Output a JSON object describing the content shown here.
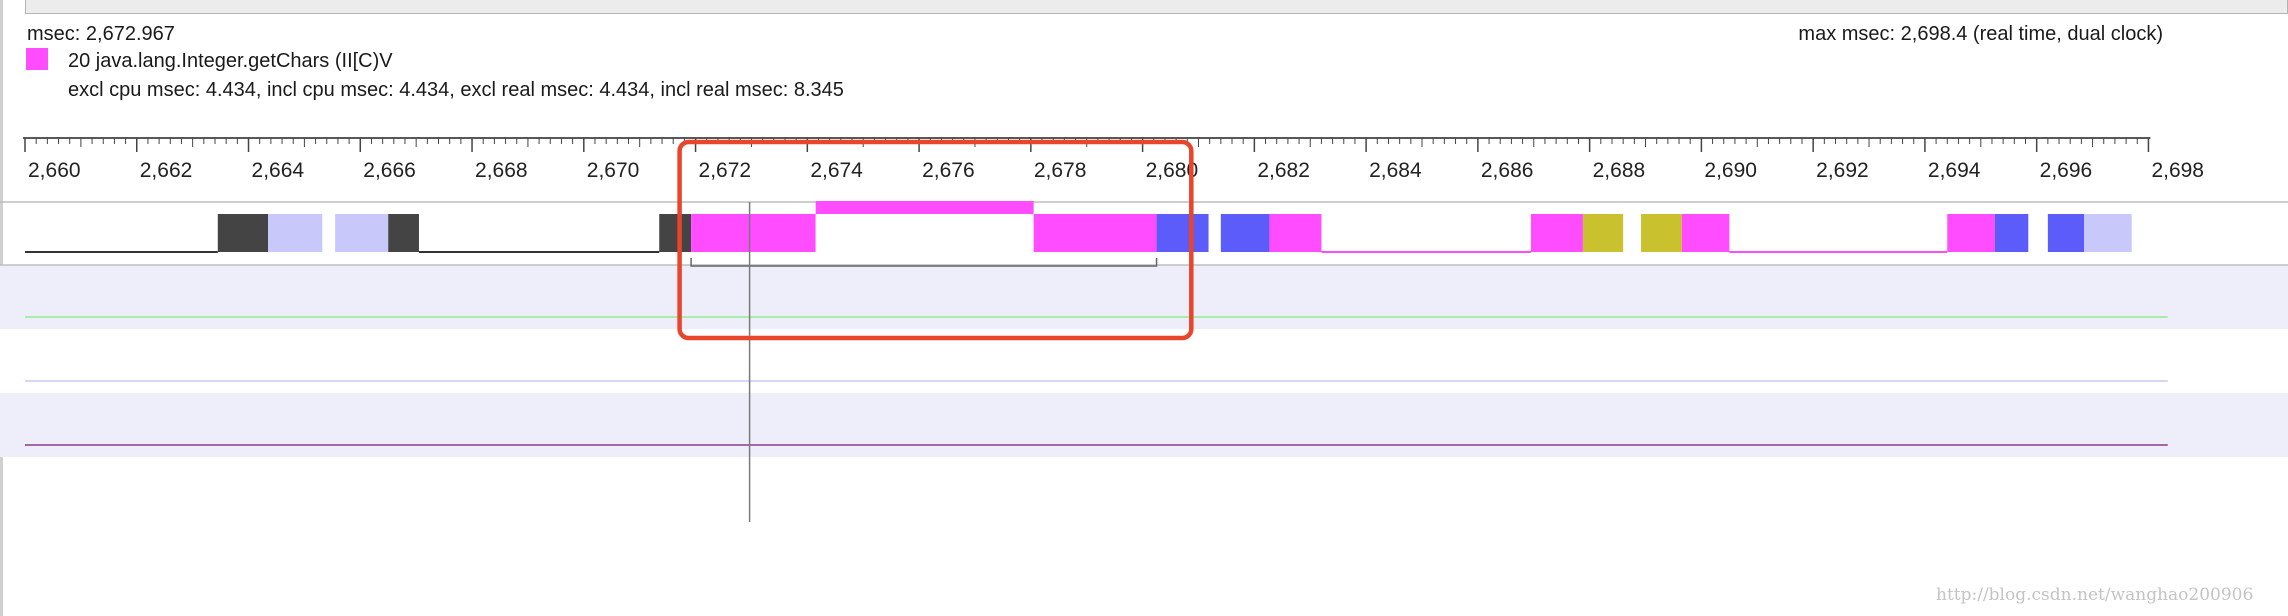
{
  "header": {
    "cursor_time": "msec: 2,672.967",
    "max_time": "max msec: 2,698.4 (real time, dual clock)",
    "method_name": "20 java.lang.Integer.getChars (II[C)V",
    "method_color": "#ff4cff",
    "method_stats": "excl cpu msec: 4.434, incl cpu msec: 4.434, excl real msec: 4.434, incl real msec: 8.345"
  },
  "ruler": {
    "labels": [
      "2,660",
      "2,662",
      "2,664",
      "2,666",
      "2,668",
      "2,670",
      "2,672",
      "2,674",
      "2,676",
      "2,678",
      "2,680",
      "2,682",
      "2,684",
      "2,686",
      "2,688",
      "2,690",
      "2,692",
      "2,694",
      "2,696",
      "2,698"
    ]
  },
  "timeline": {
    "cursor_msec": 2672.967,
    "max_msec": 2698.4,
    "segments": [
      {
        "start": 2663.45,
        "end": 2664.35,
        "color": "#444444"
      },
      {
        "start": 2664.35,
        "end": 2665.32,
        "color": "#c8c8fa"
      },
      {
        "start": 2665.55,
        "end": 2666.5,
        "color": "#c8c8fa"
      },
      {
        "start": 2666.5,
        "end": 2667.05,
        "color": "#444444"
      },
      {
        "start": 2671.35,
        "end": 2671.92,
        "color": "#444444"
      },
      {
        "start": 2671.92,
        "end": 2674.15,
        "color": "#ff4cff"
      },
      {
        "start": 2674.15,
        "end": 2678.05,
        "color": "#ffffff"
      },
      {
        "start": 2678.05,
        "end": 2680.25,
        "color": "#ff4cff"
      },
      {
        "start": 2680.25,
        "end": 2681.18,
        "color": "#5c5cfa"
      },
      {
        "start": 2681.4,
        "end": 2682.27,
        "color": "#5c5cfa"
      },
      {
        "start": 2682.27,
        "end": 2683.2,
        "color": "#ff4cff"
      },
      {
        "start": 2686.95,
        "end": 2687.88,
        "color": "#ff4cff"
      },
      {
        "start": 2687.88,
        "end": 2688.6,
        "color": "#c9c22e"
      },
      {
        "start": 2688.92,
        "end": 2689.65,
        "color": "#c9c22e"
      },
      {
        "start": 2689.65,
        "end": 2690.5,
        "color": "#ff4cff"
      },
      {
        "start": 2694.4,
        "end": 2695.25,
        "color": "#ff4cff"
      },
      {
        "start": 2695.25,
        "end": 2695.85,
        "color": "#5c5cfa"
      },
      {
        "start": 2696.2,
        "end": 2696.85,
        "color": "#5c5cfa"
      },
      {
        "start": 2696.85,
        "end": 2697.7,
        "color": "#c8c8fa"
      }
    ],
    "baselines": [
      {
        "start": 2660,
        "end": 2663.45,
        "color": "#333333"
      },
      {
        "start": 2667.05,
        "end": 2671.35,
        "color": "#333333"
      },
      {
        "start": 2683.2,
        "end": 2686.95,
        "color": "#ff4cff"
      },
      {
        "start": 2690.5,
        "end": 2694.4,
        "color": "#ff4cff"
      }
    ],
    "selection_bracket": {
      "start": 2671.92,
      "end": 2680.25
    },
    "tracks": [
      {
        "background": "#eeeefa",
        "line_color": "#90ee90"
      },
      {
        "background": "#ffffff",
        "line_color": "#c8c8fa"
      },
      {
        "background": "#eeeefa",
        "line_color": "#8b3a8b"
      }
    ]
  },
  "annotation": {
    "start": 2671.75,
    "end": 2680.8,
    "color": "#e8452c"
  },
  "watermark": "http://blog.csdn.net/wanghao200906"
}
